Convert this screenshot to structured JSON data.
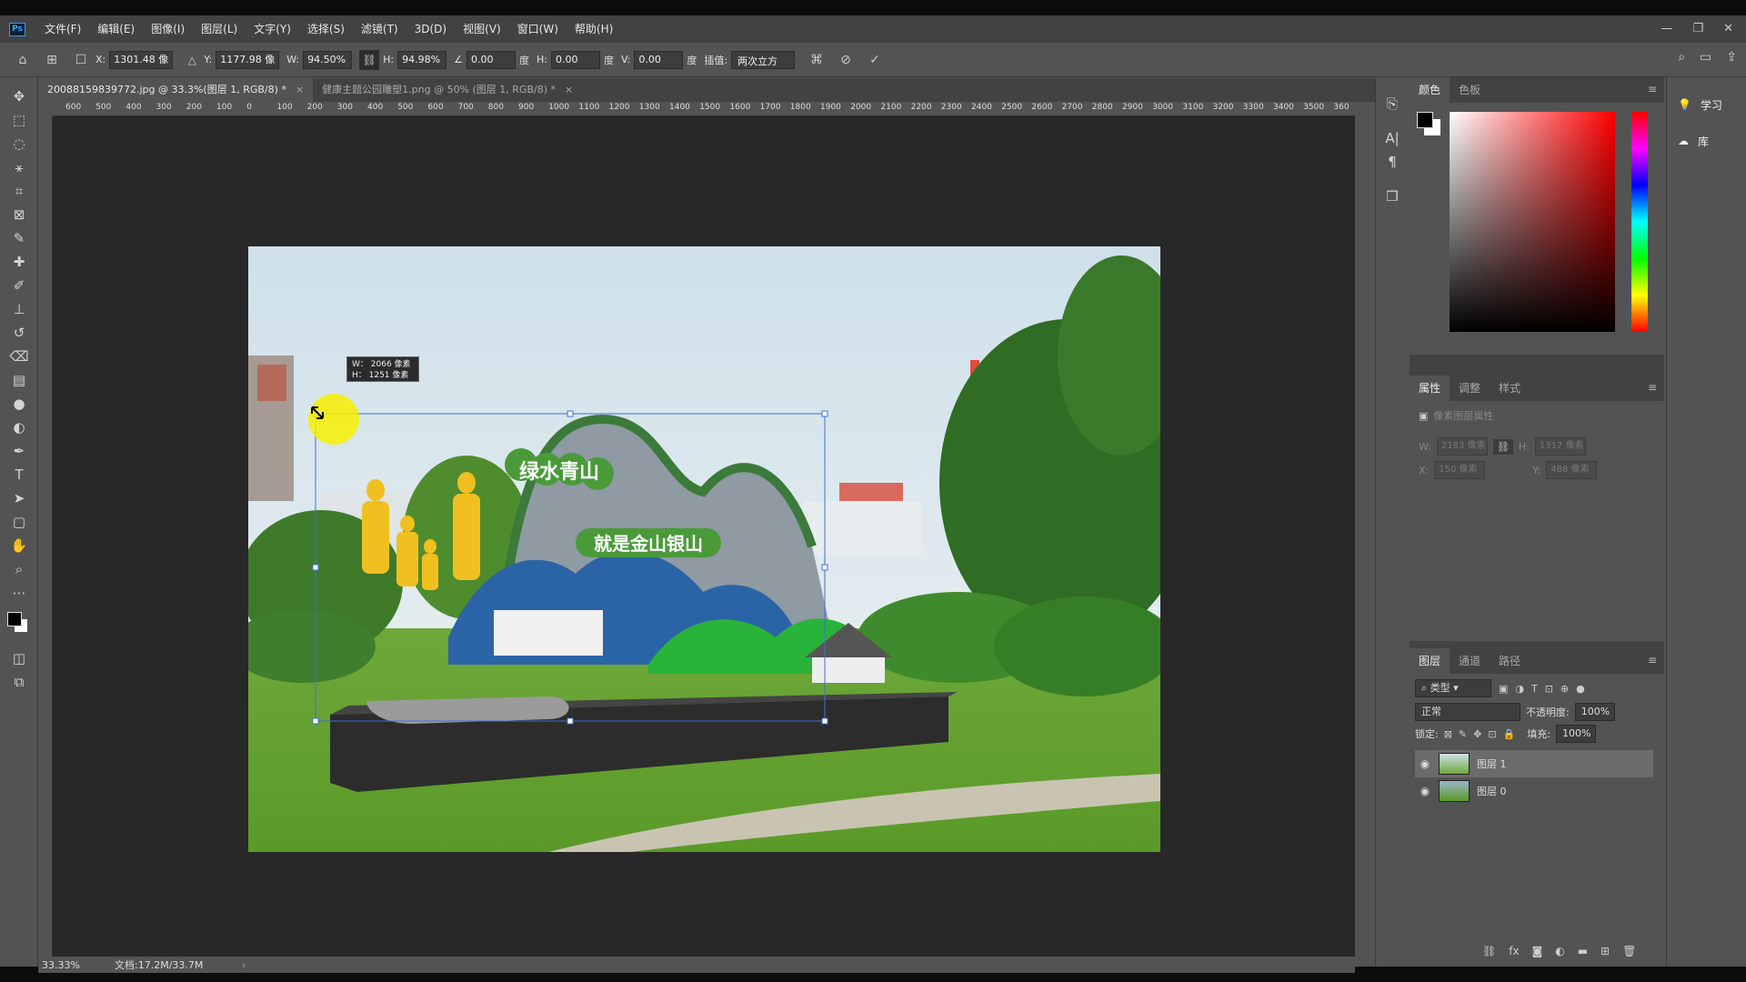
{
  "menubar": {
    "logo": "Ps",
    "items": [
      "文件(F)",
      "编辑(E)",
      "图像(I)",
      "图层(L)",
      "文字(Y)",
      "选择(S)",
      "滤镜(T)",
      "3D(D)",
      "视图(V)",
      "窗口(W)",
      "帮助(H)"
    ],
    "controls": [
      "—",
      "❐",
      "✕"
    ]
  },
  "options": {
    "x_label": "X:",
    "x_value": "1301.48 像",
    "y_label": "Y:",
    "y_value": "1177.98 像",
    "w_label": "W:",
    "w_value": "94.50%",
    "h_label": "H:",
    "h_value": "94.98%",
    "angle_value": "0.00",
    "angle_unit": "度",
    "hskew_label": "H:",
    "hskew_value": "0.00",
    "hskew_unit": "度",
    "vskew_label": "V:",
    "vskew_value": "0.00",
    "vskew_unit": "度",
    "interp_label": "插值:",
    "interp_value": "两次立方"
  },
  "tabs": [
    {
      "label": "20088159839772.jpg @ 33.3%(图层 1, RGB/8) *",
      "close": "×"
    },
    {
      "label": "健康主题公园雕塑1.png @ 50% (图层 1, RGB/8) *",
      "close": "×"
    }
  ],
  "ruler": {
    "ticks": [
      "600",
      "500",
      "400",
      "300",
      "200",
      "100",
      "0",
      "100",
      "200",
      "300",
      "400",
      "500",
      "600",
      "700",
      "800",
      "900",
      "1000",
      "1100",
      "1200",
      "1300",
      "1400",
      "1500",
      "1600",
      "1700",
      "1800",
      "1900",
      "2000",
      "2100",
      "2200",
      "2300",
      "2400",
      "2500",
      "2600",
      "2700",
      "2800",
      "2900",
      "3000",
      "3100",
      "3200",
      "3300",
      "3400",
      "3500",
      "360"
    ]
  },
  "transform_tooltip": {
    "w": "W： 2066 像素",
    "h": "H： 1251 像素"
  },
  "sculpture": {
    "line1": "绿水青山",
    "line2": "就是金山银山"
  },
  "status": {
    "zoom": "33.33%",
    "doc": "文档:17.2M/33.7M"
  },
  "color_panel": {
    "tabs": [
      "颜色",
      "色板"
    ]
  },
  "properties_panel": {
    "tabs": [
      "属性",
      "调整",
      "样式"
    ],
    "title": "像素图层属性",
    "w_label": "W:",
    "w_value": "2183 像素",
    "h_label": "H:",
    "h_value": "1317 像素",
    "x_label": "X:",
    "x_value": "150 像素",
    "y_label": "Y:",
    "y_value": "488 像素"
  },
  "layers_panel": {
    "tabs": [
      "图层",
      "通道",
      "路径"
    ],
    "filter": "类型",
    "blend_mode": "正常",
    "opacity_label": "不透明度:",
    "opacity_value": "100%",
    "lock_label": "锁定:",
    "fill_label": "填充:",
    "fill_value": "100%",
    "layers": [
      {
        "name": "图层 1",
        "selected": true
      },
      {
        "name": "图层 0",
        "selected": false
      }
    ]
  },
  "learn_panel": {
    "learn": "学习",
    "library": "库"
  }
}
